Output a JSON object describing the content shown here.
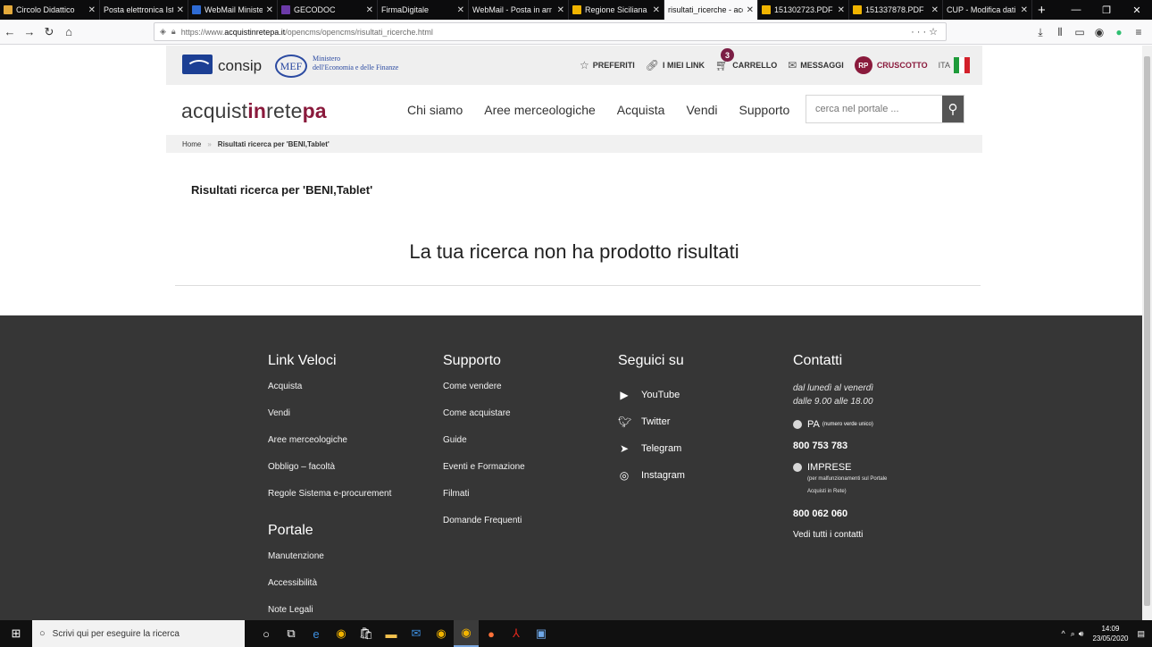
{
  "browser": {
    "tabs": [
      {
        "title": "Circolo Didattico",
        "color": "#e3a93b"
      },
      {
        "title": "Posta elettronica Istru",
        "color": "#0c0c0d"
      },
      {
        "title": "WebMail Minister",
        "color": "#2e6bd4"
      },
      {
        "title": "GECODOC",
        "color": "#6b3aa8"
      },
      {
        "title": "FirmaDigitale",
        "color": "#0c0c0d"
      },
      {
        "title": "WebMail - Posta in arr",
        "color": "#0c0c0d"
      },
      {
        "title": "Regione Siciliana",
        "color": "#f0b400"
      },
      {
        "title": "risultati_ricerche - acq",
        "color": "#ffffff"
      },
      {
        "title": "151302723.PDF",
        "color": "#f0b400"
      },
      {
        "title": "151337878.PDF",
        "color": "#f0b400"
      },
      {
        "title": "CUP - Modifica dati",
        "color": "#0c0c0d"
      }
    ],
    "active_tab_index": 7,
    "url_prefix": "https://www.",
    "url_host": "acquistinretepa.it",
    "url_path": "/opencms/opencms/risultati_ricerche.html"
  },
  "site": {
    "consip_label": "consip",
    "mef_logo": "MEF",
    "mef_line1": "Ministero",
    "mef_line2": "dell'Economia e delle Finanze",
    "topnav": {
      "preferiti": "PREFERITI",
      "miei_link": "I MIEI LINK",
      "carrello": "CARRELLO",
      "cart_count": "3",
      "messaggi": "MESSAGGI",
      "user_initials": "RP",
      "cruscotto": "CRUSCOTTO",
      "lang": "ITA"
    },
    "brand_a": "acquist",
    "brand_b": "in",
    "brand_c": "rete",
    "brand_d": "pa",
    "mainnav": [
      "Chi siamo",
      "Aree merceologiche",
      "Acquista",
      "Vendi",
      "Supporto"
    ],
    "search_placeholder": "cerca nel portale ...",
    "breadcrumb_home": "Home",
    "breadcrumb_current": "Risultati ricerca per 'BENI,Tablet'"
  },
  "main": {
    "results_title": "Risultati ricerca per 'BENI,Tablet'",
    "no_results": "La tua ricerca non ha prodotto risultati"
  },
  "footer": {
    "link_veloci": {
      "title": "Link Veloci",
      "items": [
        "Acquista",
        "Vendi",
        "Aree merceologiche",
        "Obbligo – facoltà",
        "Regole Sistema e-procurement"
      ]
    },
    "portale": {
      "title": "Portale",
      "items": [
        "Manutenzione",
        "Accessibilità",
        "Note Legali"
      ]
    },
    "supporto": {
      "title": "Supporto",
      "items": [
        "Come vendere",
        "Come acquistare",
        "Guide",
        "Eventi e Formazione",
        "Filmati",
        "Domande Frequenti"
      ]
    },
    "seguici": {
      "title": "Seguici su",
      "items": [
        "YouTube",
        "Twitter",
        "Telegram",
        "Instagram"
      ]
    },
    "contatti": {
      "title": "Contatti",
      "hours_1": "dal lunedì al venerdì",
      "hours_2": "dalle 9.00 alle 18.00",
      "pa_label": "PA",
      "pa_note": "(numero verde unico)",
      "pa_number": "800 753 783",
      "imprese_label": "IMPRESE",
      "imprese_note_1": "(per malfunzionamenti sul Portale",
      "imprese_note_2": "Acquisti in Rete)",
      "imprese_number": "800 062 060",
      "all_contacts": "Vedi tutti i contatti"
    }
  },
  "taskbar": {
    "search_placeholder": "Scrivi qui per eseguire la ricerca",
    "time": "14:09",
    "date": "23/05/2020"
  },
  "colors": {
    "brand": "#8a1a3c",
    "footer_bg": "#363636"
  }
}
